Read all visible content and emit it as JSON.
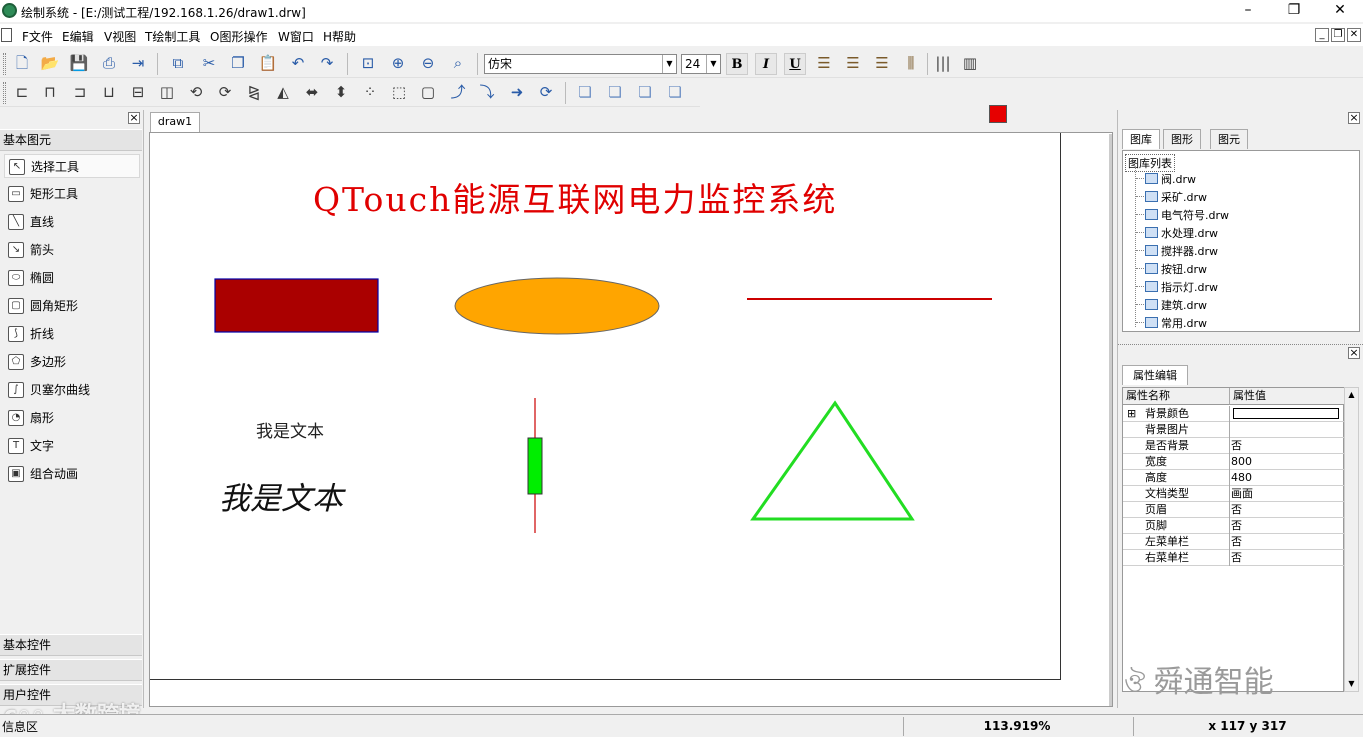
{
  "window": {
    "title": "绘制系统 - [E:/测试工程/192.168.1.26/draw1.drw]",
    "controls": {
      "minimize": "–",
      "restore": "❐",
      "close": "✕"
    }
  },
  "menu": {
    "items": [
      {
        "label": "F文件"
      },
      {
        "label": "E编辑"
      },
      {
        "label": "V视图"
      },
      {
        "label": "T绘制工具"
      },
      {
        "label": "O图形操作"
      },
      {
        "label": "W窗口"
      },
      {
        "label": "H帮助"
      }
    ],
    "mdi": {
      "minimize": "_",
      "restore": "❐",
      "close": "✕"
    }
  },
  "toolbar": {
    "font_name": "仿宋",
    "font_size": "24",
    "bold": "B",
    "italic": "I",
    "underline": "U",
    "color_swatch": "#e60000"
  },
  "left_panel": {
    "section_basic": "基本图元",
    "tools": [
      {
        "label": "选择工具",
        "icon": "pointer-icon",
        "glyph": "↖"
      },
      {
        "label": "矩形工具",
        "icon": "rectangle-icon",
        "glyph": "▭"
      },
      {
        "label": "直线",
        "icon": "line-icon",
        "glyph": "╲"
      },
      {
        "label": "箭头",
        "icon": "arrow-icon",
        "glyph": "↘"
      },
      {
        "label": "椭圆",
        "icon": "ellipse-icon",
        "glyph": "⬭"
      },
      {
        "label": "圆角矩形",
        "icon": "rounded-rect-icon",
        "glyph": "▢"
      },
      {
        "label": "折线",
        "icon": "polyline-icon",
        "glyph": "⟆"
      },
      {
        "label": "多边形",
        "icon": "polygon-icon",
        "glyph": "⬠"
      },
      {
        "label": "贝塞尔曲线",
        "icon": "bezier-icon",
        "glyph": "∫"
      },
      {
        "label": "扇形",
        "icon": "sector-icon",
        "glyph": "◔"
      },
      {
        "label": "文字",
        "icon": "text-icon",
        "glyph": "T"
      },
      {
        "label": "组合动画",
        "icon": "animation-icon",
        "glyph": "▣"
      }
    ],
    "section_controls": "基本控件",
    "section_ext": "扩展控件",
    "section_user": "用户控件"
  },
  "document": {
    "tab_label": "draw1",
    "title_text": "QTouch能源互联网电力监控系统",
    "text_plain": "我是文本",
    "text_italic": "我是文本",
    "colors": {
      "title": "#e00000",
      "rect_fill": "#aa0000",
      "rect_stroke": "#0000aa",
      "ellipse_fill": "#ffa500",
      "line": "#cc0000",
      "bar_fill": "#00ee00",
      "triangle": "#22dd22"
    }
  },
  "right_panel": {
    "tabs": [
      {
        "label": "图库"
      },
      {
        "label": "图形"
      },
      {
        "label": "图元"
      }
    ],
    "tree_root": "图库列表",
    "library_files": [
      "阀.drw",
      "采矿.drw",
      "电气符号.drw",
      "水处理.drw",
      "搅拌器.drw",
      "按钮.drw",
      "指示灯.drw",
      "建筑.drw",
      "常用.drw"
    ],
    "props_tab": "属性编辑",
    "props_header": {
      "name": "属性名称",
      "value": "属性值"
    },
    "properties": [
      {
        "name": "背景颜色",
        "value": "",
        "expand": "⊞"
      },
      {
        "name": "背景图片",
        "value": ""
      },
      {
        "name": "是否背景",
        "value": "否"
      },
      {
        "name": "宽度",
        "value": "800"
      },
      {
        "name": "高度",
        "value": "480"
      },
      {
        "name": "文档类型",
        "value": "画面"
      },
      {
        "name": "页眉",
        "value": "否"
      },
      {
        "name": "页脚",
        "value": "否"
      },
      {
        "name": "左菜单栏",
        "value": "否"
      },
      {
        "name": "右菜单栏",
        "value": "否"
      }
    ]
  },
  "status": {
    "info_label": "信息区",
    "zoom": "113.919%",
    "coords": "x 117 y 317"
  },
  "watermarks": {
    "left": "大数跨境",
    "right": "舜通智能"
  }
}
